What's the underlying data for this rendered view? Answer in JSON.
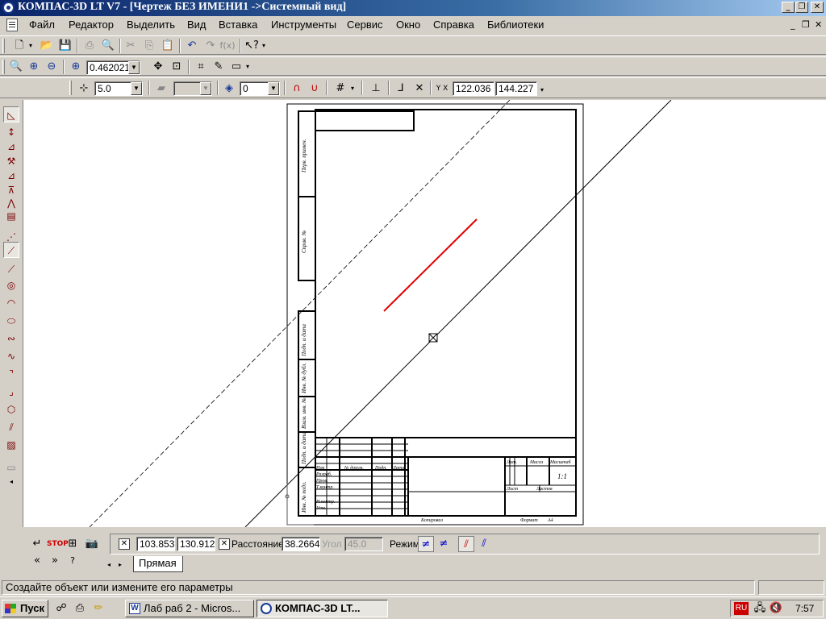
{
  "window": {
    "title": "КОМПАС-3D LT V7 - [Чертеж БЕЗ ИМЕНИ1 ->Системный вид]",
    "controls": {
      "minimize": "_",
      "restore": "❐",
      "close": "✕"
    },
    "mdi_controls": {
      "minimize": "_",
      "restore": "❐",
      "close": "✕"
    }
  },
  "menu": [
    "Файл",
    "Редактор",
    "Выделить",
    "Вид",
    "Вставка",
    "Инструменты",
    "Сервис",
    "Окно",
    "Справка",
    "Библиотеки"
  ],
  "toolbar_view": {
    "zoom_value": "0.462021"
  },
  "toolbar_current": {
    "step_value": "5.0",
    "style_value": "",
    "layer_value": "0",
    "coord_x": "122.036",
    "coord_y": "144.227"
  },
  "panel": {
    "point_x": "103.853",
    "point_y": "130.912",
    "distance_label": "Расстояние",
    "distance_value": "38.2664",
    "angle_label": "Угол",
    "angle_value": "45.0",
    "mode_label": "Режим",
    "tab_label": "Прямая"
  },
  "status": {
    "message": "Создайте объект или измените его параметры"
  },
  "taskbar": {
    "start": "Пуск",
    "tasks": [
      {
        "label": "Лаб раб 2 - Micros..."
      },
      {
        "label": "КОМПАС-3D LT..."
      }
    ],
    "lang": "RU",
    "time": "7:57"
  },
  "drawing": {
    "side_labels": [
      "Перв. примен.",
      "Справ. №",
      "Подп. и дата",
      "Инв. № дубл.",
      "Взам. инв. №",
      "Подп. и дата",
      "Инв. № подл."
    ],
    "stamp": {
      "rows": [
        "Изм",
        "Разраб.",
        "Пров.",
        "Т.контр.",
        "Н.контр.",
        "Утв."
      ],
      "headers": [
        "Лист",
        "№ докум.",
        "Подп.",
        "Дата"
      ],
      "lit": "Лит.",
      "mass": "Масса",
      "scale": "Масштаб",
      "scale_value": "1:1",
      "sheet": "Лист",
      "sheets": "Листов",
      "copied": "Копировал",
      "format": "Формат",
      "format_value": "A4"
    }
  }
}
